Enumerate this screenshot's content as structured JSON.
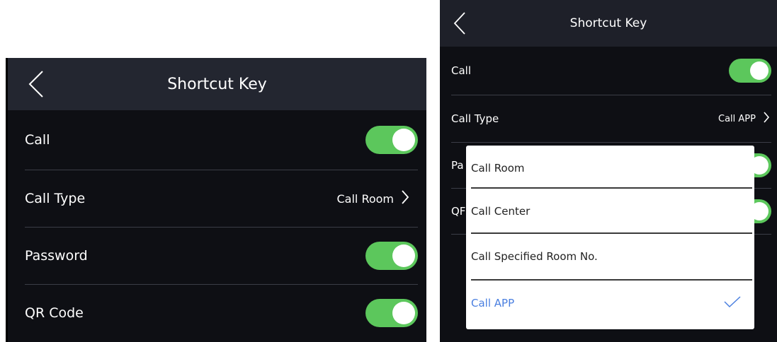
{
  "left_screen": {
    "header": {
      "title": "Shortcut Key"
    },
    "rows": [
      {
        "label": "Call",
        "type": "toggle",
        "on": true
      },
      {
        "label": "Call Type",
        "type": "value",
        "value": "Call Room"
      },
      {
        "label": "Password",
        "type": "toggle",
        "on": true
      },
      {
        "label": "QR Code",
        "type": "toggle",
        "on": true
      }
    ]
  },
  "right_screen": {
    "header": {
      "title": "Shortcut Key"
    },
    "rows": [
      {
        "label": "Call",
        "type": "toggle",
        "on": true
      },
      {
        "label": "Call Type",
        "type": "value",
        "value": "Call APP"
      },
      {
        "label": "Pa",
        "type": "toggle",
        "on": true
      },
      {
        "label": "QF",
        "type": "toggle",
        "on": true
      }
    ],
    "popup": {
      "options": [
        {
          "label": "Call Room",
          "selected": false
        },
        {
          "label": "Call Center",
          "selected": false
        },
        {
          "label": "Call Specified Room No.",
          "selected": false
        },
        {
          "label": "Call APP",
          "selected": true
        }
      ]
    }
  },
  "colors": {
    "background": "#0e0f14",
    "header": "#232630",
    "toggle_on": "#5cc75c",
    "selected_text": "#4a7fe0"
  },
  "icons": {
    "back": "chevron-left-icon",
    "value_arrow": "chevron-right-icon",
    "selected": "check-icon"
  }
}
